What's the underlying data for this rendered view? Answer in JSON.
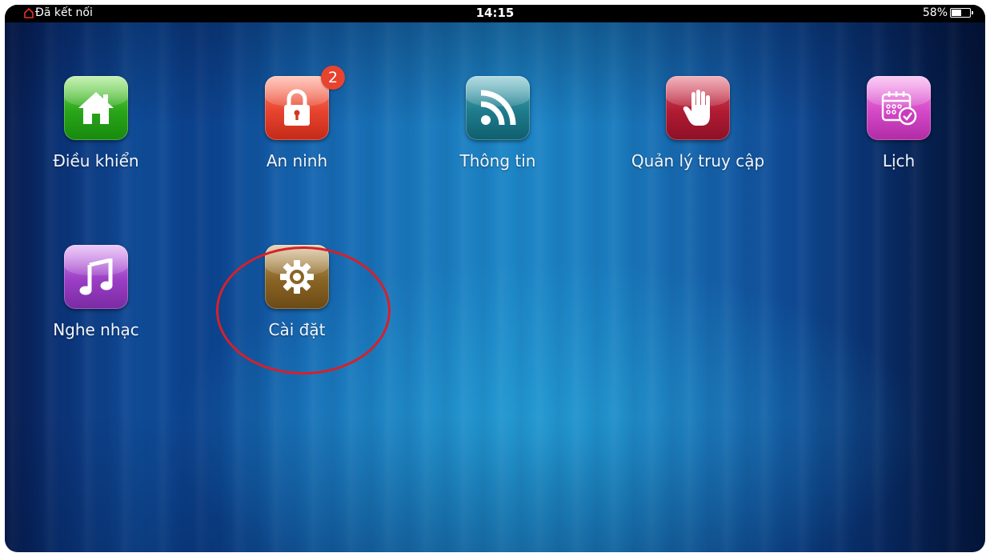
{
  "status_bar": {
    "connection_text": "Đã kết nối",
    "time": "14:15",
    "battery_percent_text": "58%",
    "battery_level": 0.58,
    "home_icon_color": "#e8322a"
  },
  "apps": [
    {
      "label": "Điều khiển",
      "icon": "home-icon",
      "color": "#2aa51a"
    },
    {
      "label": "An ninh",
      "icon": "lock-icon",
      "color": "#e8442f",
      "badge": "2"
    },
    {
      "label": "Thông tin",
      "icon": "rss-icon",
      "color": "#1e7c8c"
    },
    {
      "label": "Quản lý truy cập",
      "icon": "hand-icon",
      "color": "#b01c34"
    },
    {
      "label": "Lịch",
      "icon": "calendar-icon",
      "color": "#d449c7"
    },
    {
      "label": "Nghe nhạc",
      "icon": "music-note-icon",
      "color": "#9a3ec4"
    },
    {
      "label": "Cài đặt",
      "icon": "gear-icon",
      "color": "#8a6425",
      "highlighted": true
    }
  ],
  "highlight_color": "#d6202a"
}
